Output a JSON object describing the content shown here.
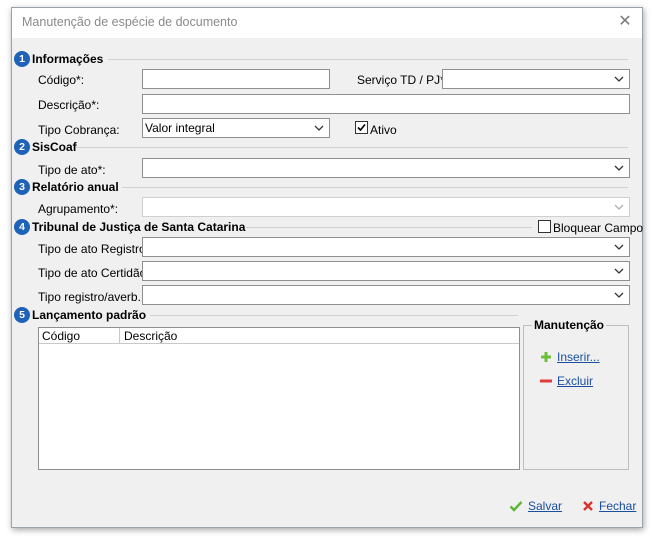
{
  "window": {
    "title": "Manutenção de espécie de documento",
    "close_symbol": "✕"
  },
  "sections": {
    "informacoes": {
      "number": "1",
      "title": "Informações"
    },
    "siscoaf": {
      "number": "2",
      "title": "SisCoaf"
    },
    "relatorio": {
      "number": "3",
      "title": "Relatório anual"
    },
    "tribunal": {
      "number": "4",
      "title": "Tribunal de Justiça de Santa Catarina"
    },
    "lancamento": {
      "number": "5",
      "title": "Lançamento padrão"
    }
  },
  "fields": {
    "codigo_label": "Código*:",
    "codigo_value": "",
    "servico_label": "Serviço TD / PJ*:",
    "servico_value": "",
    "descricao_label": "Descrição*:",
    "descricao_value": "",
    "tipo_cobranca_label": "Tipo Cobrança:",
    "tipo_cobranca_value": "Valor integral",
    "ativo_label": "Ativo",
    "ativo_checked": true,
    "tipo_ato_label": "Tipo de ato*:",
    "tipo_ato_value": "",
    "agrupamento_label": "Agrupamento*:",
    "agrupamento_value": "",
    "bloquear_label": "Bloquear Campo",
    "bloquear_checked": false,
    "tipo_ato_registro_label": "Tipo de ato Registro:",
    "tipo_ato_registro_value": "",
    "tipo_ato_certidao_label": "Tipo de ato Certidão:",
    "tipo_ato_certidao_value": "",
    "tipo_registro_averb_label": "Tipo registro/averb.:",
    "tipo_registro_averb_value": ""
  },
  "grid": {
    "columns": [
      "Código",
      "Descrição"
    ],
    "rows": []
  },
  "manutencao": {
    "title": "Manutenção",
    "inserir": "Inserir...",
    "excluir": "Excluir"
  },
  "footer": {
    "salvar": "Salvar",
    "fechar": "Fechar"
  },
  "colors": {
    "badge": "#1e63b8",
    "link": "#1a4fa0",
    "add_icon": "#6bbf3a",
    "remove_icon": "#e03a3a",
    "save_icon": "#5cb531",
    "close_icon": "#d9332f"
  },
  "icons": {
    "add": "plus-icon",
    "remove": "minus-icon",
    "save": "checkmark-icon",
    "close": "x-icon"
  }
}
